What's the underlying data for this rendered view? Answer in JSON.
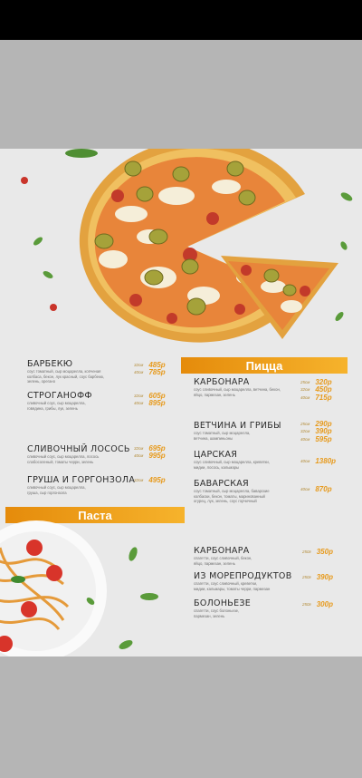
{
  "section_pizza": "Пицца",
  "section_pasta": "Паста",
  "left_pizzas": [
    {
      "name": "БАРБЕКЮ",
      "desc": [
        "соус томатный, сыр моцарелла, копченая",
        "колбаса, бекон, лук красный, соус барбекю,",
        "зелень, орегано"
      ],
      "prices": [
        [
          "32см",
          "485р"
        ],
        [
          "40см",
          "785р"
        ]
      ]
    },
    {
      "name": "СТРОГАНОФФ",
      "desc": [
        "сливочный соус, сыр моцарелла,",
        "говядина, грибы, лук, зелень"
      ],
      "prices": [
        [
          "32см",
          "605р"
        ],
        [
          "40см",
          "895р"
        ]
      ]
    },
    {
      "name": "СЛИВОЧНЫЙ ЛОСОСЬ",
      "desc": [
        "сливочный соус, сыр моцарелла, лосось",
        "слабосоленый, томаты черри, зелень"
      ],
      "prices": [
        [
          "32см",
          "695р"
        ],
        [
          "40см",
          "995р"
        ]
      ]
    },
    {
      "name": "ГРУША И ГОРГОНЗОЛА",
      "desc": [
        "сливочный соус, сыр моцарелла,",
        "груша, сыр горгонзола"
      ],
      "prices": [
        [
          "32см",
          "495р"
        ]
      ]
    }
  ],
  "right_pizzas": [
    {
      "name": "КАРБОНАРА",
      "desc": [
        "соус сливочный, сыр моцарелла, ветчина, бекон,",
        "яйцо, пармезан, зелень"
      ],
      "prices": [
        [
          "25см",
          "320р"
        ],
        [
          "32см",
          "450р"
        ],
        [
          "40см",
          "715р"
        ]
      ]
    },
    {
      "name": "ВЕТЧИНА И ГРИБЫ",
      "desc": [
        "соус томатный, сыр моцарелла,",
        "ветчина, шампиньоны"
      ],
      "prices": [
        [
          "25см",
          "290р"
        ],
        [
          "32см",
          "390р"
        ],
        [
          "40см",
          "595р"
        ]
      ]
    },
    {
      "name": "ЦАРСКАЯ",
      "desc": [
        "соус сливочный, сыр моцарелла, креветки,",
        "мидии, лосось, кальмары"
      ],
      "prices": [
        [
          "40см",
          "1380р"
        ]
      ]
    },
    {
      "name": "БАВАРСКАЯ",
      "desc": [
        "соус томатный, сыр моцарелла, баварские",
        "колбаски, бекон, томаты, маринованный",
        "огурец, лук, зелень, соус горчичный"
      ],
      "prices": [
        [
          "40см",
          "870р"
        ]
      ]
    }
  ],
  "pasta": [
    {
      "name": "КАРБОНАРА",
      "desc": [
        "спагетти, соус сливочный, бекон,",
        "яйцо, пармезан, зелень"
      ],
      "prices": [
        [
          "250г",
          "350р"
        ]
      ]
    },
    {
      "name": "ИЗ МОРЕПРОДУКТОВ",
      "desc": [
        "спагетти, соус сливочный, креветки,",
        "мидии, кальмары, томаты черри, пармезан"
      ],
      "prices": [
        [
          "250г",
          "390р"
        ]
      ]
    },
    {
      "name": "БОЛОНЬЕЗЕ",
      "desc": [
        "спагетти, соус болоньезе,",
        "пармезан, зелень"
      ],
      "prices": [
        [
          "250г",
          "300р"
        ]
      ]
    }
  ]
}
